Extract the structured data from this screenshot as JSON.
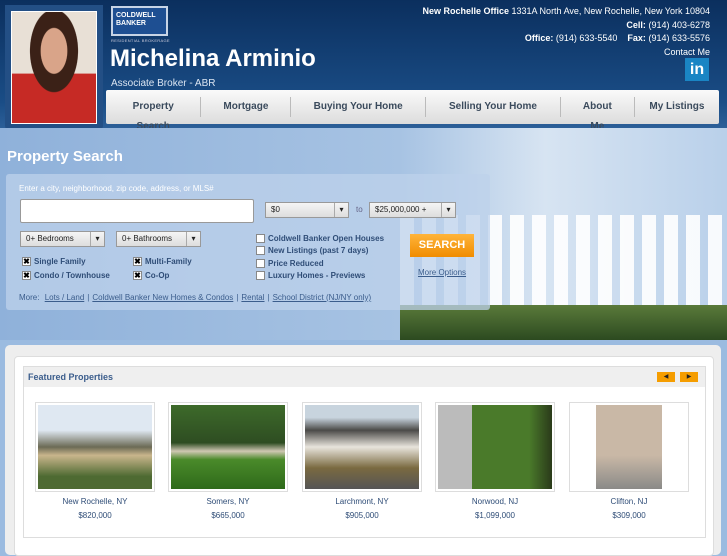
{
  "header": {
    "logo": "COLDWELL BANKER",
    "logo_sub": "RESIDENTIAL BROKERAGE",
    "name": "Michelina Arminio",
    "title": "Associate Broker - ABR",
    "office_label": "New Rochelle Office",
    "office_address": "1331A North Ave, New Rochelle, New York 10804",
    "cell_label": "Cell:",
    "cell": "(914) 403-6278",
    "office_phone_label": "Office:",
    "office_phone": "(914) 633-5540",
    "fax_label": "Fax:",
    "fax": "(914) 633-5576",
    "contact": "Contact Me",
    "linkedin": "in"
  },
  "nav": [
    "Property Search",
    "Mortgage",
    "Buying Your Home",
    "Selling Your Home",
    "About Me",
    "My Listings"
  ],
  "search": {
    "heading": "Property Search",
    "hint": "Enter a city, neighborhood, zip code, address, or MLS#",
    "query": "",
    "price_min": "$0",
    "to": "to",
    "price_max": "$25,000,000 +",
    "bedrooms": "0+ Bedrooms",
    "bathrooms": "0+ Bathrooms",
    "types": [
      {
        "label": "Single Family",
        "checked": true
      },
      {
        "label": "Multi-Family",
        "checked": true
      },
      {
        "label": "Condo / Townhouse",
        "checked": true
      },
      {
        "label": "Co-Op",
        "checked": true
      }
    ],
    "filters": [
      "Coldwell Banker Open Houses",
      "New Listings (past 7 days)",
      "Price Reduced",
      "Luxury Homes - Previews"
    ],
    "button": "SEARCH",
    "more_options": "More Options",
    "more_label": "More:",
    "more_links": [
      "Lots / Land",
      "Coldwell Banker New Homes & Condos",
      "Rental",
      "School District (NJ/NY only)"
    ]
  },
  "featured": {
    "title": "Featured Properties",
    "prev": "◀",
    "next": "▶",
    "items": [
      {
        "city": "New Rochelle, NY",
        "price": "$820,000"
      },
      {
        "city": "Somers, NY",
        "price": "$665,000"
      },
      {
        "city": "Larchmont, NY",
        "price": "$905,000"
      },
      {
        "city": "Norwood, NJ",
        "price": "$1,099,000"
      },
      {
        "city": "Clifton, NJ",
        "price": "$309,000"
      }
    ]
  }
}
